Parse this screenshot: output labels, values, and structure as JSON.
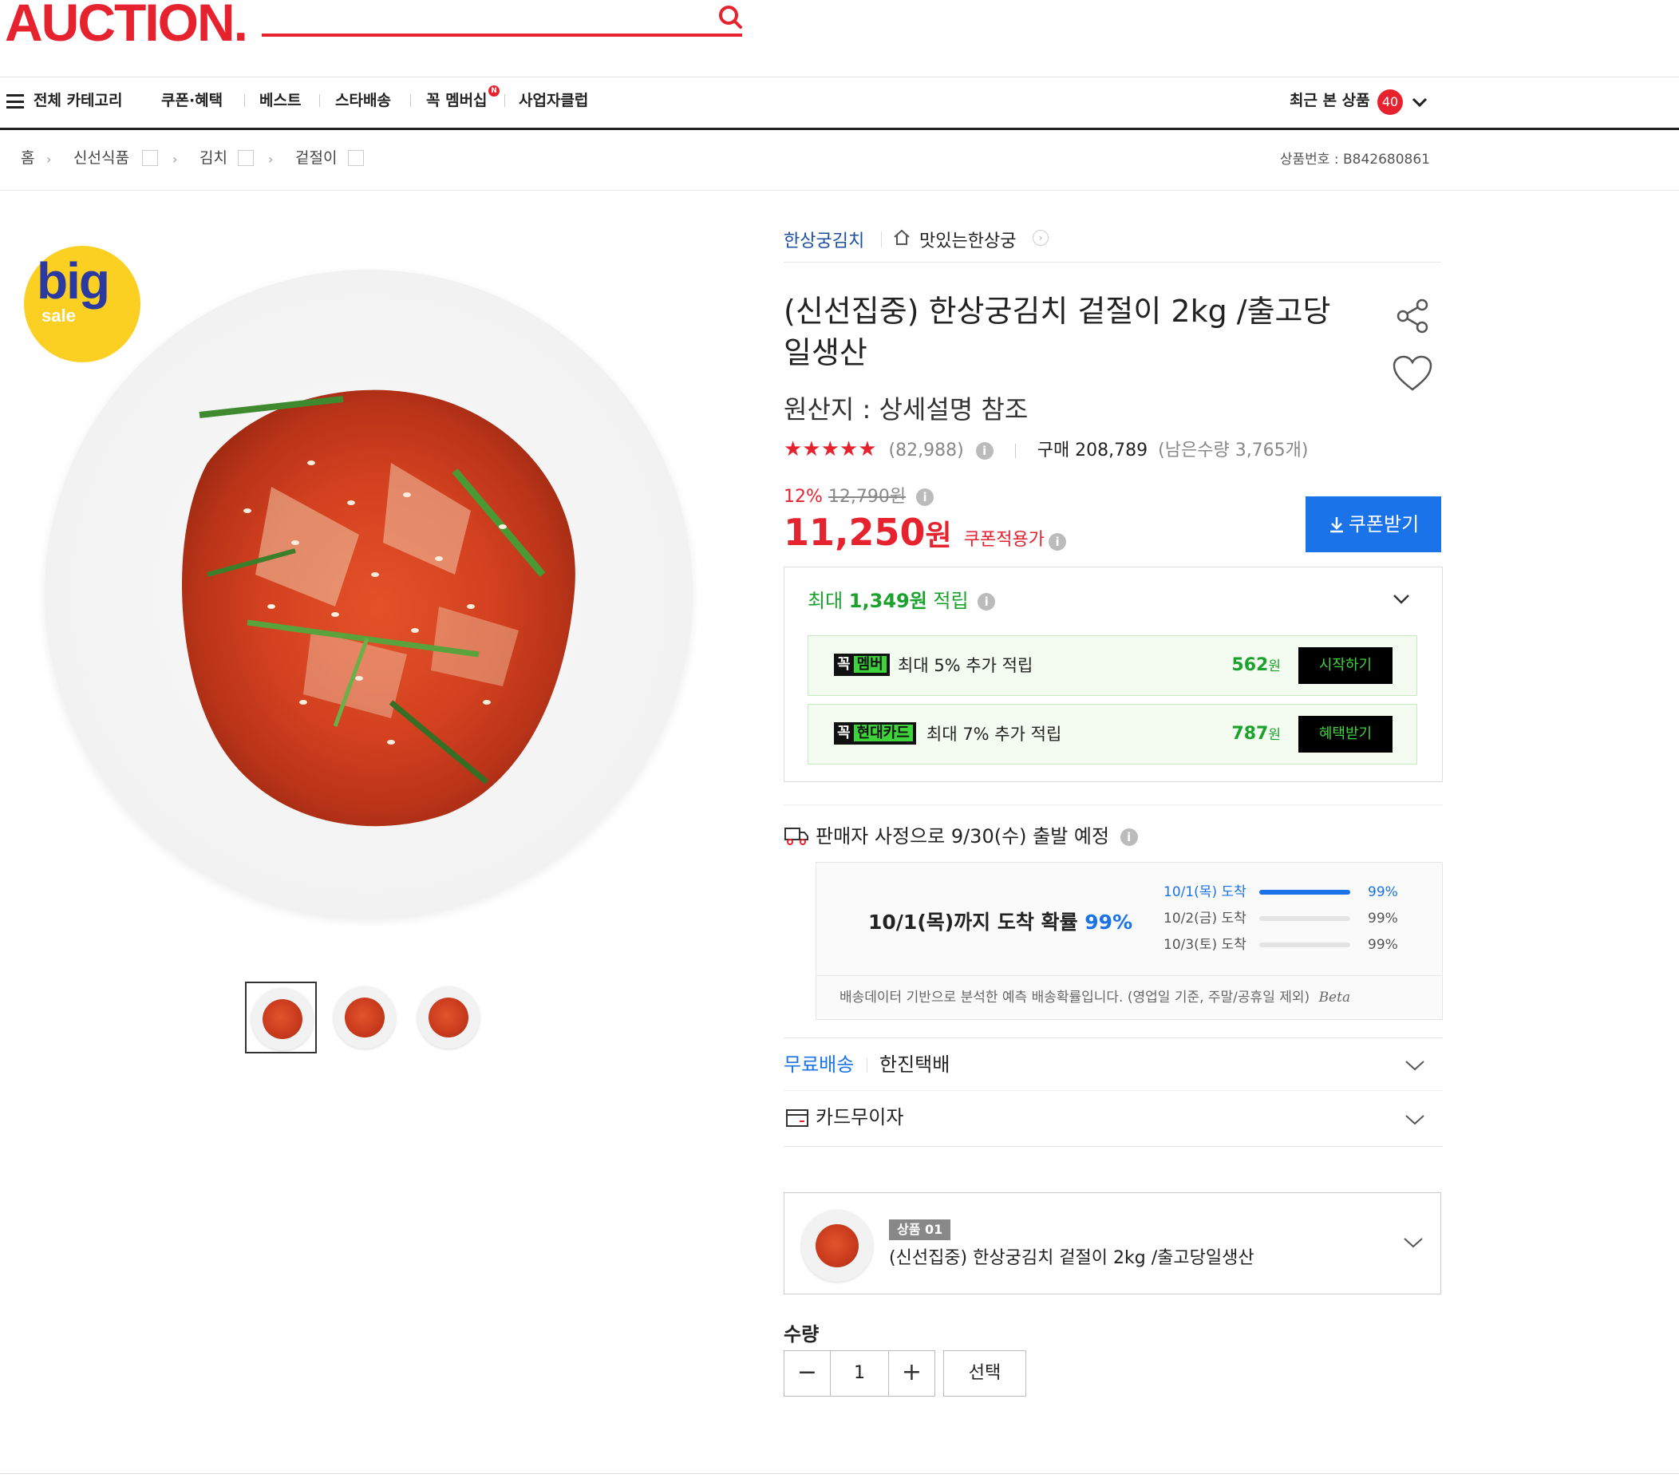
{
  "header": {
    "logo": "AUCTION.",
    "search_placeholder": ""
  },
  "nav": {
    "all_categories": "전체 카테고리",
    "items": [
      "쿠폰·혜택",
      "베스트",
      "스타배송",
      "꼭 멤버십",
      "사업자클럽"
    ],
    "membership_badge": "N",
    "recent_label": "최근 본 상품",
    "recent_count": "40"
  },
  "breadcrumb": {
    "items": [
      "홈",
      "신선식품",
      "김치",
      "겉절이"
    ],
    "product_number": "상품번호 : B842680861"
  },
  "product": {
    "badge_big": "big",
    "badge_sale": "sale",
    "store_brand": "한상궁김치",
    "store_name": "맛있는한상궁",
    "title": "(신선집중) 한상궁김치 겉절이 2kg /출고당일생산",
    "origin": "원산지 : 상세설명 참조",
    "rating_stars": "★★★★★",
    "rating_value": 4.5,
    "review_count": "(82,988)",
    "purchase_label": "구매 208,789",
    "stock_label": "(남은수량 3,765개)",
    "discount_pct": "12%",
    "original_price": "12,790원",
    "price": "11,250",
    "price_unit": "원",
    "coupon_price_label": "쿠폰적용가",
    "coupon_button": "쿠폰받기"
  },
  "rewards": {
    "title_prefix": "최대 ",
    "title_amount": "1,349원",
    "title_suffix": " 적립",
    "rows": [
      {
        "tag_black": "꼭",
        "tag_green": "멤버",
        "text": "최대 5% 추가 적립",
        "amount": "562",
        "unit": "원",
        "button": "시작하기"
      },
      {
        "tag_black": "꼭",
        "tag_green": "현대카드",
        "text": "최대 7% 추가 적립",
        "amount": "787",
        "unit": "원",
        "button": "혜택받기"
      }
    ]
  },
  "shipping": {
    "notice": "판매자 사정으로 9/30(수) 출발 예정",
    "prob_main": "10/1(목)까지 도착 확률 ",
    "prob_main_pct": "99%",
    "rows": [
      {
        "label": "10/1(목) 도착",
        "pct": "99%",
        "fill": 1.0,
        "active": true
      },
      {
        "label": "10/2(금) 도착",
        "pct": "99%",
        "fill": 0.0,
        "active": false
      },
      {
        "label": "10/3(토) 도착",
        "pct": "99%",
        "fill": 0.0,
        "active": false
      }
    ],
    "note": "배송데이터 기반으로 분석한 예측 배송확률입니다. (영업일 기준, 주말/공휴일 제외)",
    "note_beta": "Beta",
    "free_shipping": "무료배송",
    "courier": "한진택배",
    "card_installment": "카드무이자"
  },
  "option": {
    "tag": "상품 01",
    "name": "(신선집중) 한상궁김치 겉절이 2kg /출고당일생산"
  },
  "quantity": {
    "label": "수량",
    "value": "1",
    "minus": "−",
    "plus": "+",
    "select_button": "선택"
  },
  "colors": {
    "brand_red": "#e7222f",
    "accent_blue": "#1a73e8",
    "reward_green": "#1aa22c"
  }
}
